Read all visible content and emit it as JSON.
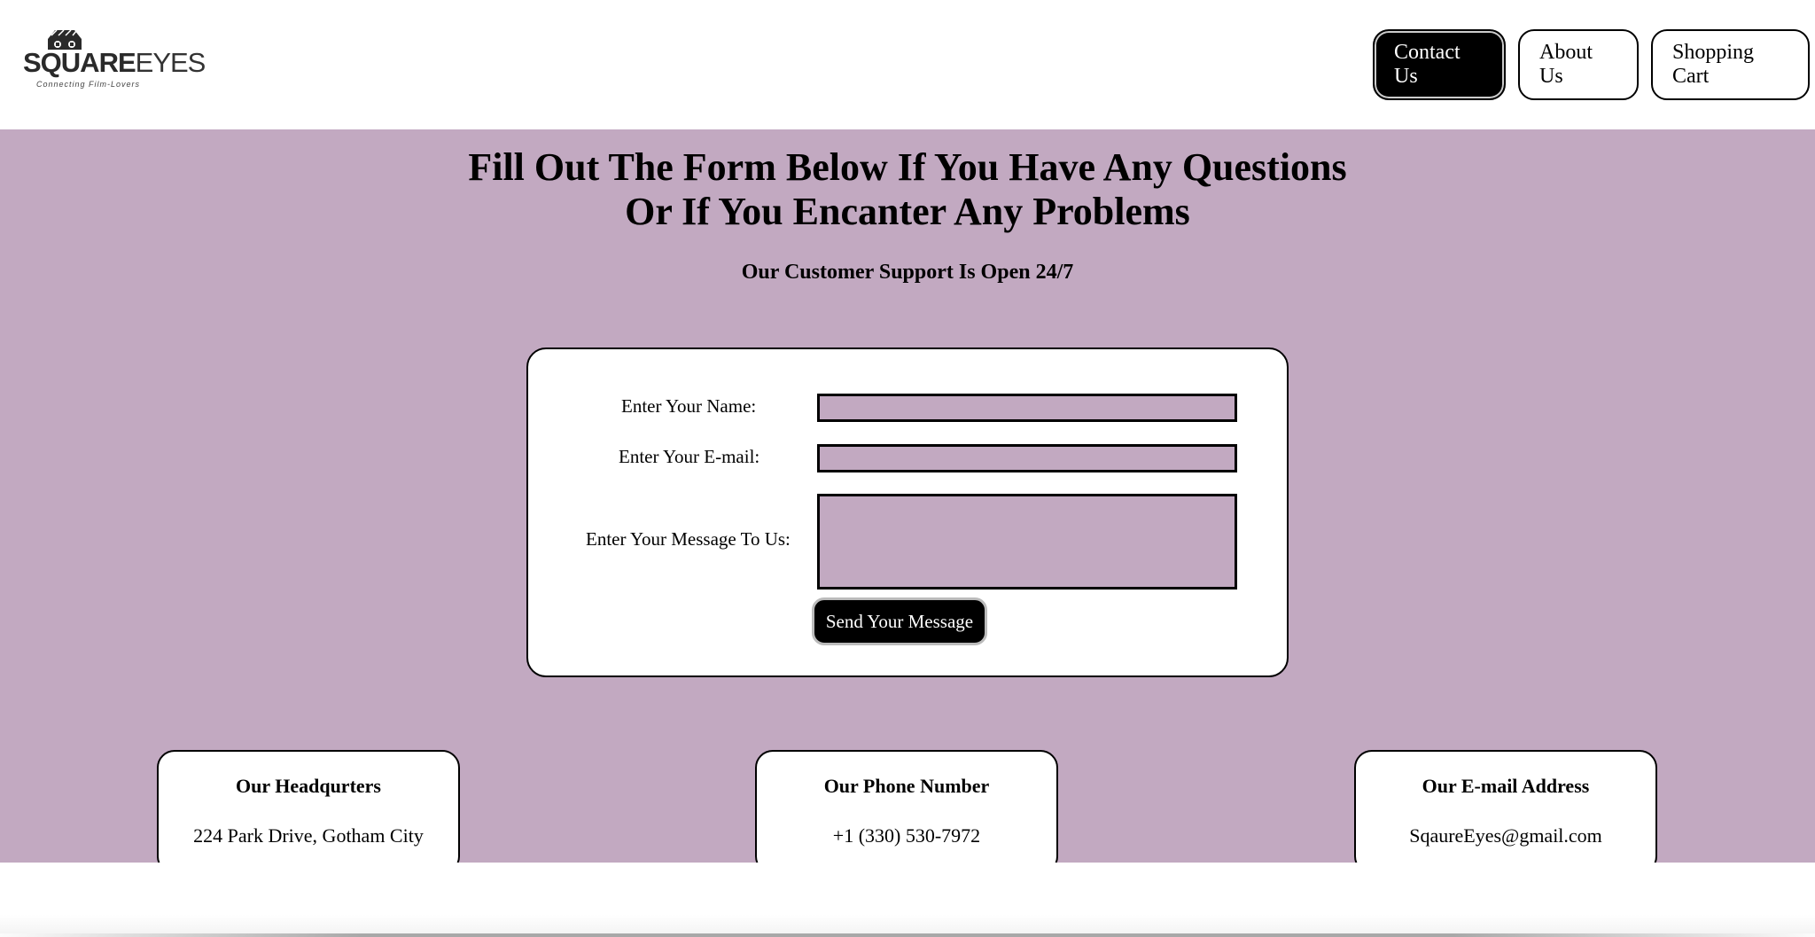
{
  "brand": {
    "name_bold": "SQUARE",
    "name_thin": "EYES",
    "tagline": "Connecting Film-Lovers",
    "icon": "clapperboard-glasses-icon"
  },
  "nav": {
    "contact_label": "Contact Us",
    "about_label": "About Us",
    "cart_label": "Shopping Cart",
    "active": "Contact Us"
  },
  "hero": {
    "headline_line1": "Fill Out The Form Below If You Have Any Questions",
    "headline_line2": "Or If You Encanter Any Problems",
    "subheadline": "Our Customer Support Is Open 24/7"
  },
  "form": {
    "name_label": "Enter Your Name:",
    "name_value": "",
    "email_label": "Enter Your E-mail:",
    "email_value": "",
    "message_label": "Enter Your Message To Us:",
    "message_value": "",
    "submit_label": "Send Your Message"
  },
  "info": {
    "headquarters_title": "Our Headqurters",
    "headquarters_value": "224 Park Drive, Gotham City",
    "phone_title": "Our Phone Number",
    "phone_value": "+1 (330) 530-7972",
    "email_title": "Our E-mail Address",
    "email_value": "SqaureEyes@gmail.com"
  },
  "colors": {
    "background_accent": "#c2a9c1",
    "card_background": "#ffffff",
    "active_button": "#000000"
  }
}
